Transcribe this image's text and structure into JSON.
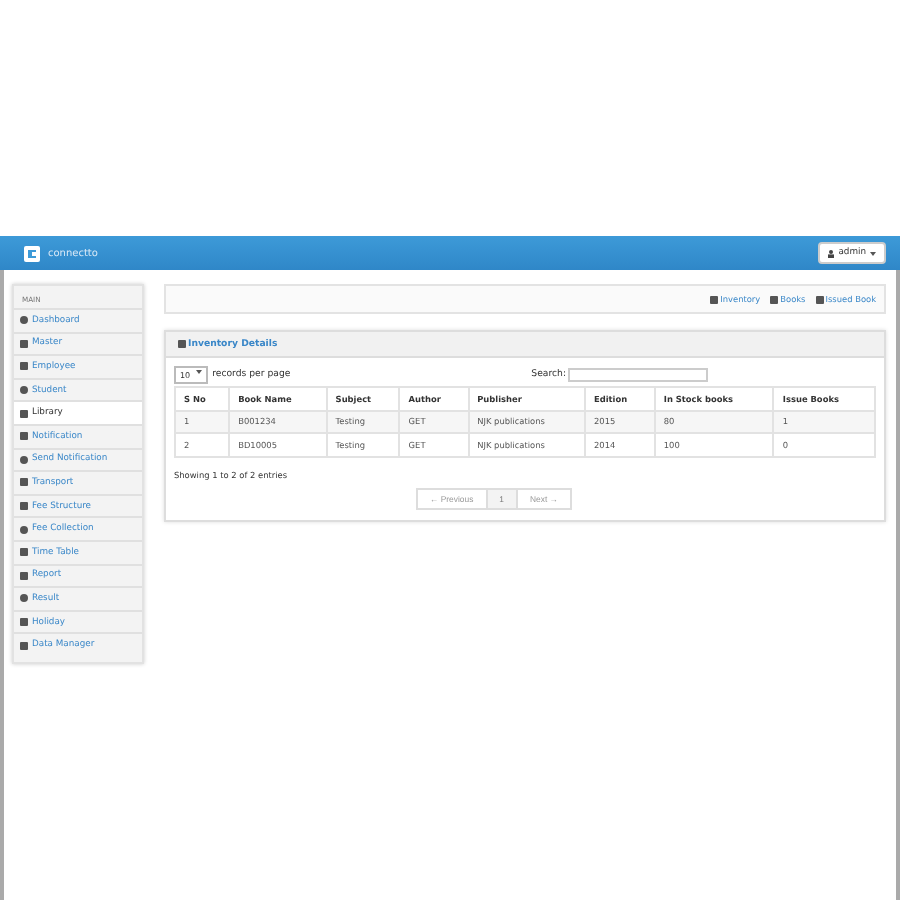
{
  "header": {
    "brand": "connectto",
    "user_button": "admin"
  },
  "sidebar": {
    "heading": "MAIN",
    "items": [
      {
        "label": "Dashboard",
        "selected": false
      },
      {
        "label": "Master",
        "selected": false
      },
      {
        "label": "Employee",
        "selected": false
      },
      {
        "label": "Student",
        "selected": false
      },
      {
        "label": "Library",
        "selected": true
      },
      {
        "label": "Notification",
        "selected": false
      },
      {
        "label": "Send Notification",
        "selected": false
      },
      {
        "label": "Transport",
        "selected": false
      },
      {
        "label": "Fee Structure",
        "selected": false
      },
      {
        "label": "Fee Collection",
        "selected": false
      },
      {
        "label": "Time Table",
        "selected": false
      },
      {
        "label": "Report",
        "selected": false
      },
      {
        "label": "Result",
        "selected": false
      },
      {
        "label": "Holiday",
        "selected": false
      },
      {
        "label": "Data Manager",
        "selected": false
      }
    ]
  },
  "breadcrumb_links": [
    "Inventory",
    "Books",
    "Issued Book"
  ],
  "panel": {
    "title": "Inventory Details",
    "page_length": "10",
    "page_length_label": "records per page",
    "search_label": "Search:",
    "table": {
      "columns": [
        "S No",
        "Book Name",
        "Subject",
        "Author",
        "Publisher",
        "Edition",
        "In Stock books",
        "Issue Books"
      ],
      "rows": [
        [
          "1",
          "B001234",
          "Testing",
          "GET",
          "NJK publications",
          "2015",
          "80",
          "1"
        ],
        [
          "2",
          "BD10005",
          "Testing",
          "GET",
          "NJK publications",
          "2014",
          "100",
          "0"
        ]
      ]
    },
    "info": "Showing 1 to 2 of 2 entries",
    "pagination": [
      {
        "label": "← Previous",
        "selected": false
      },
      {
        "label": "1",
        "selected": true
      },
      {
        "label": "Next →",
        "selected": false
      }
    ]
  }
}
